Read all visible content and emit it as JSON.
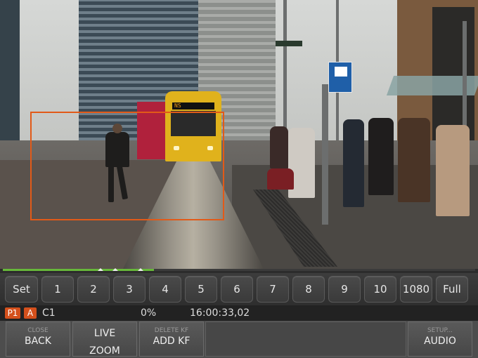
{
  "viewport": {
    "tram_sign_text": "NS"
  },
  "timeline": {
    "progress_fraction": 0.32,
    "colors": {
      "fill": "#67b83a",
      "track": "#3b3b3b"
    }
  },
  "preset_bar": {
    "buttons": [
      "Set",
      "1",
      "2",
      "3",
      "4",
      "5",
      "6",
      "7",
      "8",
      "9",
      "10",
      "1080",
      "Full"
    ]
  },
  "status_bar": {
    "badge_p": "P1",
    "badge_a": "A",
    "camera": "C1",
    "percent": "0%",
    "timecode": "16:00:33,02",
    "badge_color": "#d4501c"
  },
  "function_bar": {
    "back": {
      "sub": "CLOSE",
      "label": "BACK"
    },
    "live_zoom": {
      "label_line1": "LIVE",
      "label_line2": "ZOOM"
    },
    "add_kf": {
      "sub": "DELETE KF",
      "label": "ADD KF"
    },
    "audio": {
      "sub": "SETUP...",
      "label": "AUDIO"
    }
  },
  "colors": {
    "roi_border": "#e25a18",
    "accent_green": "#67b83a"
  }
}
